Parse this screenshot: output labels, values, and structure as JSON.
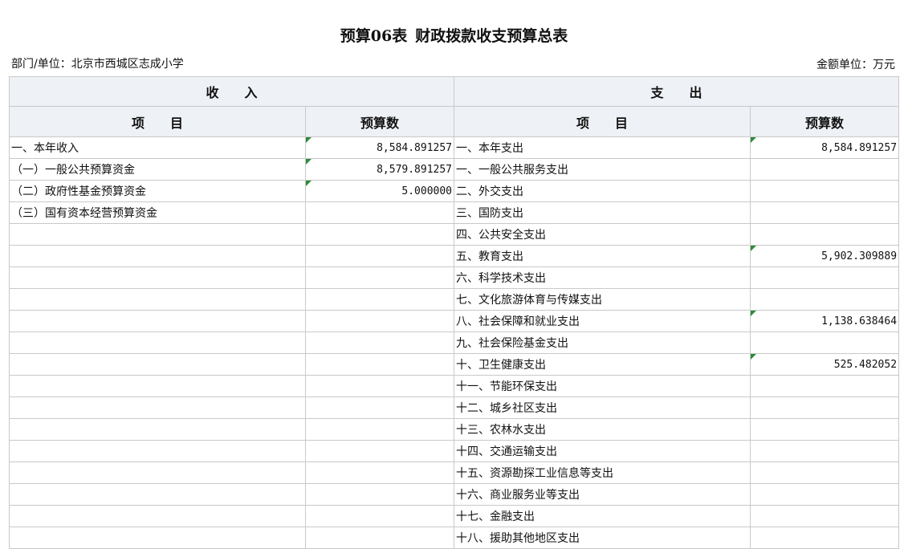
{
  "document": {
    "title_part1": "预算06表",
    "title_part2": "财政拨款收支预算总表",
    "department": "部门/单位：北京市西城区志成小学",
    "unit": "金额单位：万元"
  },
  "table": {
    "income_header": "收　　入",
    "expense_header": "支　　出",
    "item_header": "项　　目",
    "budget_header": "预算数",
    "rows": [
      {
        "income_item": "一、本年收入",
        "income_value": "8,584.891257",
        "expense_item": "一、本年支出",
        "expense_value": "8,584.891257"
      },
      {
        "income_item": "（一）一般公共预算资金",
        "income_value": "8,579.891257",
        "expense_item": "一、一般公共服务支出",
        "expense_value": ""
      },
      {
        "income_item": "（二）政府性基金预算资金",
        "income_value": "5.000000",
        "expense_item": "二、外交支出",
        "expense_value": ""
      },
      {
        "income_item": "（三）国有资本经营预算资金",
        "income_value": "",
        "expense_item": "三、国防支出",
        "expense_value": ""
      },
      {
        "income_item": "",
        "income_value": "",
        "expense_item": "四、公共安全支出",
        "expense_value": ""
      },
      {
        "income_item": "",
        "income_value": "",
        "expense_item": "五、教育支出",
        "expense_value": "5,902.309889"
      },
      {
        "income_item": "",
        "income_value": "",
        "expense_item": "六、科学技术支出",
        "expense_value": ""
      },
      {
        "income_item": "",
        "income_value": "",
        "expense_item": "七、文化旅游体育与传媒支出",
        "expense_value": ""
      },
      {
        "income_item": "",
        "income_value": "",
        "expense_item": "八、社会保障和就业支出",
        "expense_value": "1,138.638464"
      },
      {
        "income_item": "",
        "income_value": "",
        "expense_item": "九、社会保险基金支出",
        "expense_value": ""
      },
      {
        "income_item": "",
        "income_value": "",
        "expense_item": "十、卫生健康支出",
        "expense_value": "525.482052"
      },
      {
        "income_item": "",
        "income_value": "",
        "expense_item": "十一、节能环保支出",
        "expense_value": ""
      },
      {
        "income_item": "",
        "income_value": "",
        "expense_item": "十二、城乡社区支出",
        "expense_value": ""
      },
      {
        "income_item": "",
        "income_value": "",
        "expense_item": "十三、农林水支出",
        "expense_value": ""
      },
      {
        "income_item": "",
        "income_value": "",
        "expense_item": "十四、交通运输支出",
        "expense_value": ""
      },
      {
        "income_item": "",
        "income_value": "",
        "expense_item": "十五、资源勘探工业信息等支出",
        "expense_value": ""
      },
      {
        "income_item": "",
        "income_value": "",
        "expense_item": "十六、商业服务业等支出",
        "expense_value": ""
      },
      {
        "income_item": "",
        "income_value": "",
        "expense_item": "十七、金融支出",
        "expense_value": ""
      },
      {
        "income_item": "",
        "income_value": "",
        "expense_item": "十八、援助其他地区支出",
        "expense_value": ""
      }
    ]
  }
}
